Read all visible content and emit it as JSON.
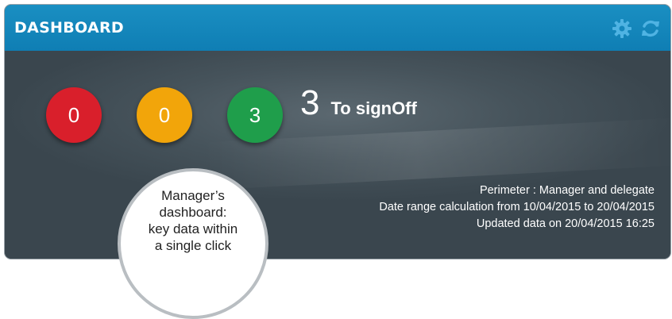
{
  "header": {
    "title": "DASHBOARD",
    "icons": [
      "gear-icon",
      "refresh-icon"
    ]
  },
  "counters": {
    "red": "0",
    "yellow": "0",
    "green": "3"
  },
  "signoff": {
    "count": "3",
    "label": "To signOff"
  },
  "info": {
    "perimeter": "Perimeter : Manager and delegate",
    "date_range": "Date range calculation from 10/04/2015 to 20/04/2015",
    "updated": "Updated data on 20/04/2015 16:25"
  },
  "callout": {
    "lines": [
      "Manager’s",
      "dashboard:",
      "key data within",
      "a single click"
    ]
  },
  "colors": {
    "header": "#1587bd",
    "panel": "#3d4a53",
    "red": "#d91f2b",
    "yellow": "#f2a50a",
    "green": "#1f9e4b"
  }
}
